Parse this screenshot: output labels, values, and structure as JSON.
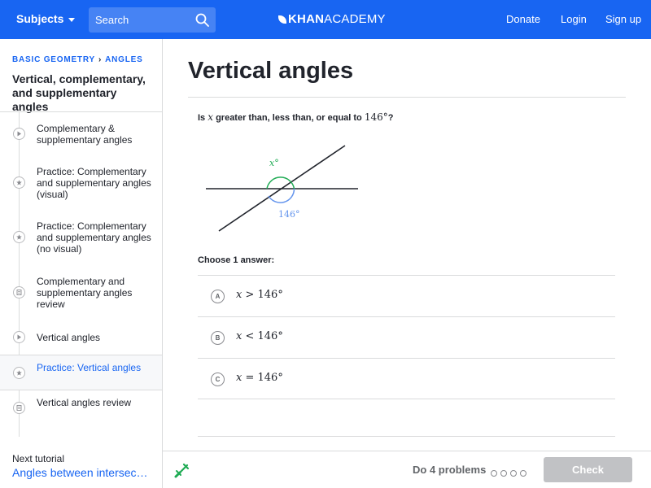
{
  "header": {
    "subjects": "Subjects",
    "search_placeholder": "Search",
    "logo_bold": "KHAN",
    "logo_light": "ACADEMY",
    "donate": "Donate",
    "login": "Login",
    "signup": "Sign up",
    "color": "#1865f2"
  },
  "sidebar": {
    "crumb_1": "BASIC GEOMETRY",
    "crumb_2": "ANGLES",
    "title": "Vertical, complementary, and supplementary angles",
    "items": [
      {
        "label": "Complementary & supplementary angles",
        "icon": "video-play-icon"
      },
      {
        "label": "Practice: Complementary and supplementary angles (visual)",
        "icon": "practice-star-icon"
      },
      {
        "label": "Practice: Complementary and supplementary angles (no visual)",
        "icon": "practice-star-icon"
      },
      {
        "label": "Complementary and supplementary angles review",
        "icon": "article-icon"
      },
      {
        "label": "Vertical angles",
        "icon": "video-play-icon"
      },
      {
        "label": "Practice: Vertical angles",
        "icon": "practice-star-icon",
        "active": true
      },
      {
        "label": "Vertical angles review",
        "icon": "article-icon"
      }
    ],
    "next_label": "Next tutorial",
    "next_link": "Angles between intersecting lines"
  },
  "main": {
    "title": "Vertical angles",
    "q_pre": "Is ",
    "q_var": "x",
    "q_mid": " greater than, less than, or equal to ",
    "q_num": "146°",
    "q_end": "?",
    "diagram": {
      "label_x": "x°",
      "label_146": "146°",
      "green": "#1fab54",
      "blue": "#6495ed"
    },
    "choose": "Choose 1 answer:",
    "choices": [
      {
        "letter": "A",
        "var": "x",
        "op": " > ",
        "val": "146°"
      },
      {
        "letter": "B",
        "var": "x",
        "op": " < ",
        "val": "146°"
      },
      {
        "letter": "C",
        "var": "x",
        "op": " = ",
        "val": "146°"
      }
    ]
  },
  "footer": {
    "progress": "Do 4 problems",
    "check": "Check"
  }
}
